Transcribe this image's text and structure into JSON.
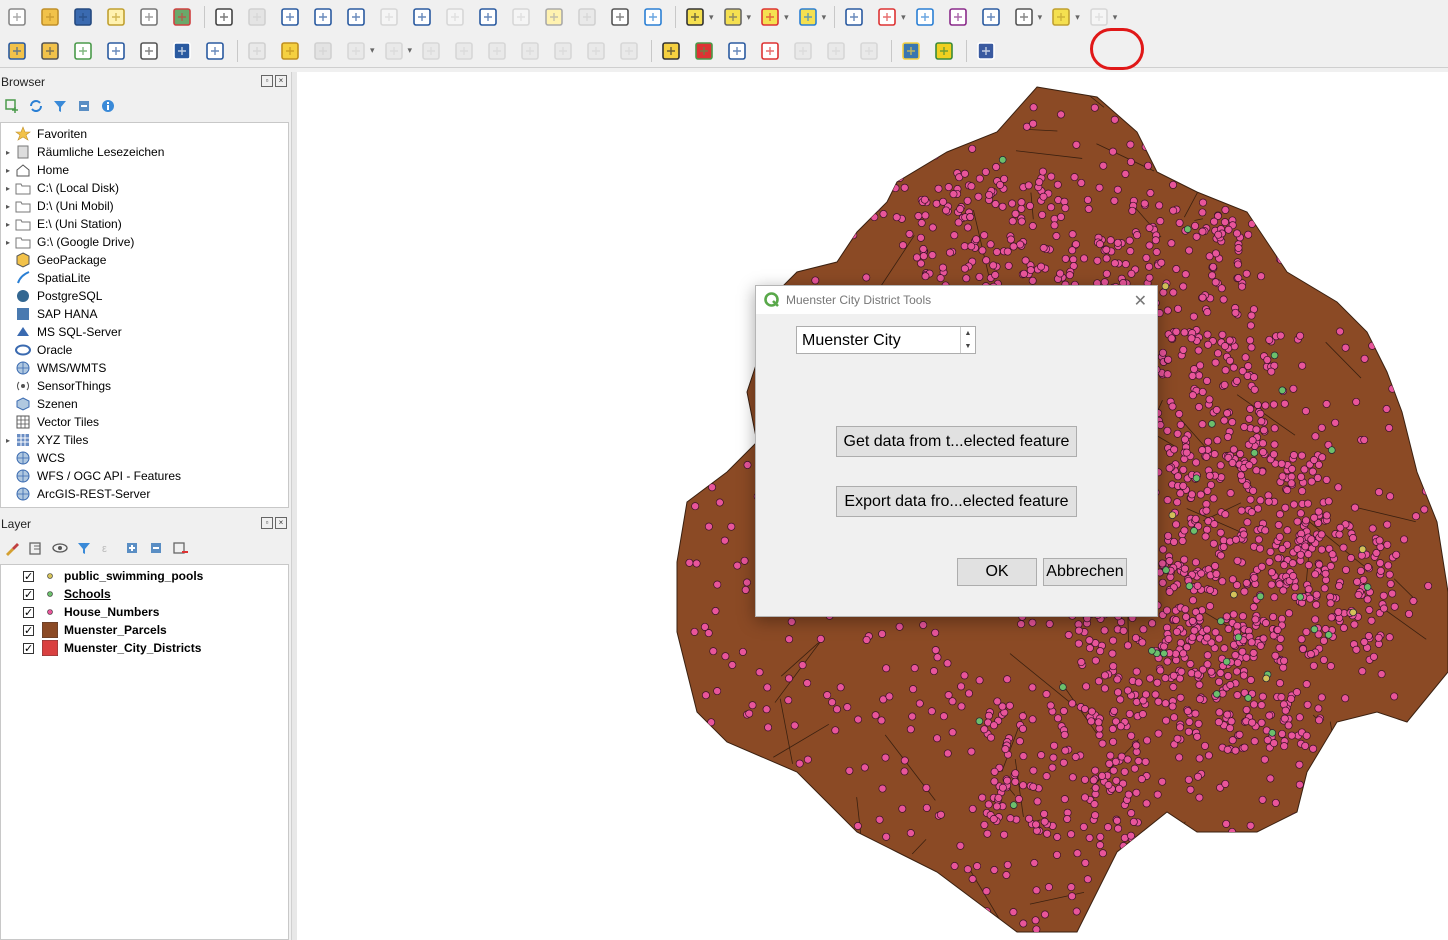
{
  "toolbar1": {
    "icons": [
      "new-project-icon",
      "open-project-icon",
      "save-project-icon",
      "new-print-layout-icon",
      "layout-manager-icon",
      "style-manager-icon",
      "pan-icon",
      "pan-to-selection-icon",
      "zoom-in-icon",
      "zoom-out-icon",
      "zoom-full-icon",
      "zoom-to-selection-icon",
      "zoom-to-layer-icon",
      "zoom-native-icon",
      "zoom-last-icon",
      "zoom-next-icon",
      "new-bookmark-icon",
      "show-bookmarks-icon",
      "temporal-controller-icon",
      "refresh-icon",
      "select-features-icon",
      "select-by-value-icon",
      "deselect-icon",
      "select-location-icon",
      "identify-icon",
      "attribute-table-icon",
      "processing-toolbox-icon",
      "statistics-icon",
      "open-field-calculator-icon",
      "measure-icon",
      "map-tips-icon",
      "locator-icon"
    ]
  },
  "toolbar2": {
    "icons": [
      "data-source-manager-icon",
      "new-geopackage-icon",
      "new-shapefile-icon",
      "new-spatialite-icon",
      "new-virtual-layer-icon",
      "new-temp-scratch-icon",
      "new-mesh-icon",
      "current-edits-icon",
      "toggle-editing-icon",
      "save-edits-icon",
      "digitize-icon",
      "vertex-tool-icon",
      "modify-attributes-icon",
      "delete-selected-icon",
      "cut-features-icon",
      "copy-features-icon",
      "paste-features-icon",
      "undo-icon",
      "redo-icon",
      "label-toolbar-icon",
      "diagram-icon",
      "pin-labels-icon",
      "show-hide-labels-icon",
      "move-label-icon",
      "rotate-label-icon",
      "change-label-icon",
      "python-console-icon",
      "muenster-plugin-icon",
      "help-icon"
    ]
  },
  "browser": {
    "title": "Browser",
    "items": [
      {
        "label": "Favoriten",
        "icon": "star-icon",
        "expandable": false
      },
      {
        "label": "Räumliche Lesezeichen",
        "icon": "bookmark-icon",
        "expandable": true
      },
      {
        "label": "Home",
        "icon": "home-icon",
        "expandable": true
      },
      {
        "label": "C:\\ (Local Disk)",
        "icon": "folder-icon",
        "expandable": true
      },
      {
        "label": "D:\\ (Uni Mobil)",
        "icon": "folder-icon",
        "expandable": true
      },
      {
        "label": "E:\\ (Uni Station)",
        "icon": "folder-icon",
        "expandable": true
      },
      {
        "label": "G:\\ (Google Drive)",
        "icon": "folder-icon",
        "expandable": true
      },
      {
        "label": "GeoPackage",
        "icon": "geopackage-icon",
        "expandable": false
      },
      {
        "label": "SpatiaLite",
        "icon": "spatialite-icon",
        "expandable": false
      },
      {
        "label": "PostgreSQL",
        "icon": "postgresql-icon",
        "expandable": false
      },
      {
        "label": "SAP HANA",
        "icon": "sap-hana-icon",
        "expandable": false
      },
      {
        "label": "MS SQL-Server",
        "icon": "mssql-icon",
        "expandable": false
      },
      {
        "label": "Oracle",
        "icon": "oracle-icon",
        "expandable": false
      },
      {
        "label": "WMS/WMTS",
        "icon": "globe-icon",
        "expandable": false
      },
      {
        "label": "SensorThings",
        "icon": "sensor-icon",
        "expandable": false
      },
      {
        "label": "Szenen",
        "icon": "scene-icon",
        "expandable": false
      },
      {
        "label": "Vector Tiles",
        "icon": "vector-tiles-icon",
        "expandable": false
      },
      {
        "label": "XYZ Tiles",
        "icon": "xyz-tiles-icon",
        "expandable": true
      },
      {
        "label": "WCS",
        "icon": "globe-icon",
        "expandable": false
      },
      {
        "label": "WFS / OGC API - Features",
        "icon": "globe-icon",
        "expandable": false
      },
      {
        "label": "ArcGIS-REST-Server",
        "icon": "globe-icon",
        "expandable": false
      }
    ]
  },
  "layers": {
    "title": "Layer",
    "items": [
      {
        "label": "public_swimming_pools",
        "symbol": "point",
        "color": "#d4c25a",
        "checked": true,
        "underline": false
      },
      {
        "label": "Schools",
        "symbol": "point",
        "color": "#6cbf6c",
        "checked": true,
        "underline": true
      },
      {
        "label": "House_Numbers",
        "symbol": "point",
        "color": "#e8559a",
        "checked": true,
        "underline": false
      },
      {
        "label": "Muenster_Parcels",
        "symbol": "polygon",
        "color": "#8b4a25",
        "checked": true,
        "underline": false
      },
      {
        "label": "Muenster_City_Districts",
        "symbol": "polygon",
        "color": "#d94040",
        "checked": true,
        "underline": false
      }
    ]
  },
  "map": {
    "parcel_color": "#8b4a25",
    "point_color": "#e8559a",
    "school_color": "#6cbf6c",
    "pool_color": "#d4c25a"
  },
  "dialog": {
    "title": "Muenster City District Tools",
    "combo_value": "Muenster City",
    "get_data_button": "Get data from t...elected feature",
    "export_data_button": "Export data fro...elected feature",
    "ok_button": "OK",
    "cancel_button": "Abbrechen"
  }
}
